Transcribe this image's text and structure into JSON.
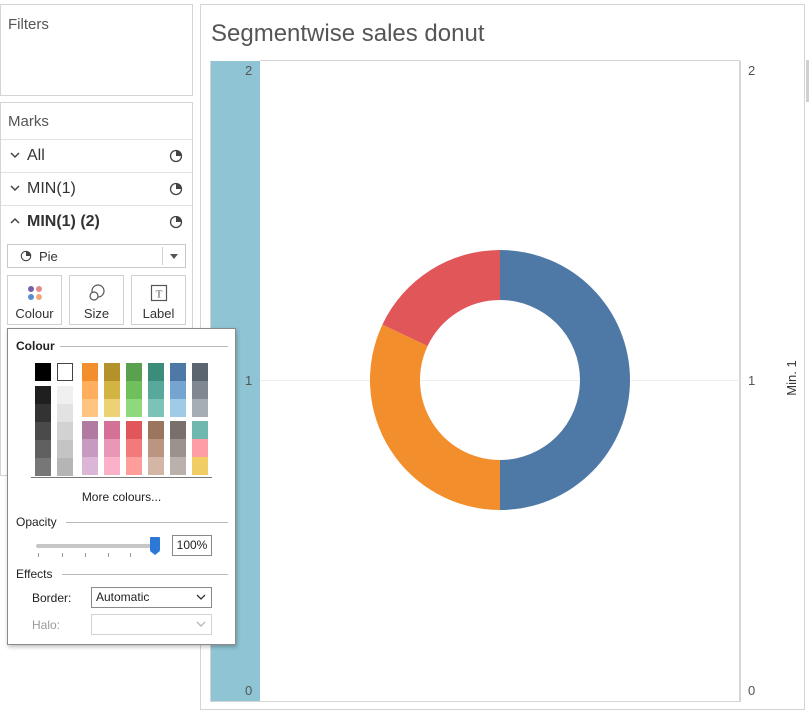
{
  "filters": {
    "title": "Filters"
  },
  "marks": {
    "title": "Marks",
    "rows": [
      {
        "label": "All",
        "expanded": false
      },
      {
        "label": "MIN(1)",
        "expanded": false
      },
      {
        "label": "MIN(1) (2)",
        "expanded": true
      }
    ],
    "mark_type": "Pie",
    "buttons": [
      {
        "label": "Colour",
        "icon": "colour-dots-icon"
      },
      {
        "label": "Size",
        "icon": "size-circles-icon"
      },
      {
        "label": "Label",
        "icon": "text-label-icon"
      }
    ]
  },
  "colour_popup": {
    "colour_title": "Colour",
    "more_colours": "More colours...",
    "opacity_title": "Opacity",
    "opacity_value": "100%",
    "opacity_fraction": 1.0,
    "effects_title": "Effects",
    "border_label": "Border:",
    "border_value": "Automatic",
    "halo_label": "Halo:",
    "halo_value": "",
    "palette": {
      "bw_top": [
        "#000000",
        "#ffffff"
      ],
      "dark_col": [
        "#1f1f1f",
        "#333333",
        "#4a4a4a",
        "#606060",
        "#777777"
      ],
      "light_col": [
        "#f0f0f0",
        "#e2e2e2",
        "#d2d2d2",
        "#c4c4c4",
        "#b5b5b5"
      ],
      "top_cols": [
        [
          "#f28e2b",
          "#ffae5d",
          "#ffc480"
        ],
        [
          "#b3922b",
          "#d1b441",
          "#ecd274"
        ],
        [
          "#59a14f",
          "#6fbf5d",
          "#8dd97c"
        ],
        [
          "#3c8c7c",
          "#58a89c",
          "#7dc2b6"
        ],
        [
          "#4e79a7",
          "#74a4cf",
          "#a0cbe8"
        ],
        [
          "#5b6570",
          "#7f8891",
          "#a7aeb3"
        ]
      ],
      "bottom_cols": [
        [
          "#b07aa1",
          "#c79ac0",
          "#dcb6d6"
        ],
        [
          "#d37295",
          "#e898b4",
          "#fab1c9"
        ],
        [
          "#e15759",
          "#f27b7a",
          "#ff9d9a"
        ],
        [
          "#9c755f",
          "#bb9482",
          "#d4b6a6"
        ],
        [
          "#79706e",
          "#9b928f",
          "#bab0ac"
        ],
        [
          "#6fb8b0",
          "#ff9da7",
          "#f1ce63"
        ]
      ]
    }
  },
  "chart": {
    "title": "Segmentwise sales donut",
    "left_ticks": [
      "2",
      "1",
      "0"
    ],
    "right_ticks": [
      "2",
      "1",
      "0"
    ],
    "right_axis_title": "Min. 1",
    "colors": {
      "band": "#8fc4d4"
    }
  },
  "chart_data": {
    "type": "pie",
    "donut": true,
    "slices": [
      {
        "value": 0.5,
        "color": "#4e79a7"
      },
      {
        "value": 0.32,
        "color": "#f28e2b"
      },
      {
        "value": 0.18,
        "color": "#e15759"
      }
    ],
    "y_axis_ticks": [
      "0",
      "1",
      "2"
    ],
    "ylim": [
      0,
      2
    ],
    "y2label": "Min. 1"
  }
}
